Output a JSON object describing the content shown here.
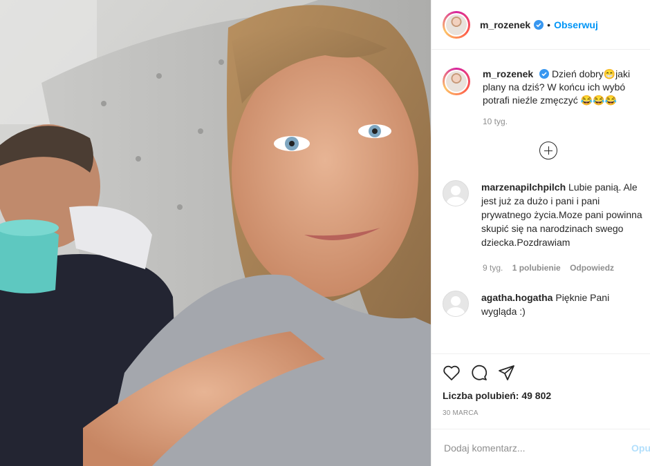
{
  "header": {
    "username": "m_rozenek",
    "separator": "•",
    "follow_label": "Obserwuj"
  },
  "caption": {
    "username": "m_rozenek",
    "line1": "Dzień dobry😁jaki",
    "line2": "plany na dziś? W końcu ich wybó",
    "line3": "potrafi nieźle zmęczyć 😂😂😂",
    "time": "10 tyg."
  },
  "comments": [
    {
      "username": "marzenapilchpilch",
      "text": "Lubie panią. Ale jest już za dużo i pani i pani prywatnego życia.Moze pani powinna skupić się na narodzinach swego dziecka.Pozdrawiam",
      "time": "9 tyg.",
      "likes": "1 polubienie",
      "reply": "Odpowiedz"
    },
    {
      "username": "agatha.hogatha",
      "text": "Pięknie Pani wygląda :)"
    }
  ],
  "post": {
    "likes_label": "Liczba polubień: 49 802",
    "date": "30 MARCA"
  },
  "composer": {
    "placeholder": "Dodaj komentarz...",
    "post_label": "Opu"
  },
  "icons": {
    "like": "heart-icon",
    "comment": "comment-icon",
    "share": "share-icon",
    "load_more": "plus-circle-icon",
    "verified": "verified-badge-icon"
  },
  "colors": {
    "link_blue": "#0095f6",
    "verified_blue": "#3897f0",
    "muted": "#8e8e8e"
  }
}
